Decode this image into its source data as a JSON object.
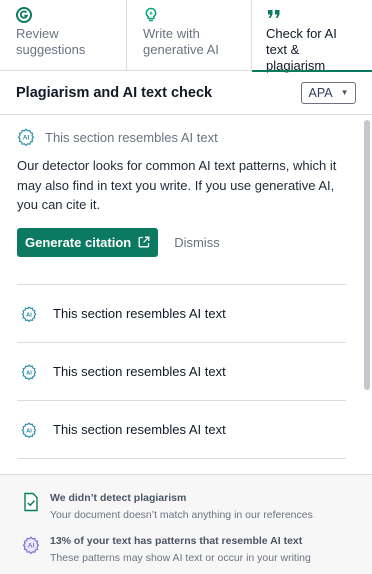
{
  "tabs": [
    {
      "label": "Review\nsuggestions",
      "icon": "grammarly-g-icon",
      "color": "#0b7a60"
    },
    {
      "label": "Write with\ngenerative AI",
      "icon": "lightbulb-icon",
      "color": "#14a37f"
    },
    {
      "label": "Check for AI\ntext & plagiarism",
      "icon": "quote-icon",
      "color": "#0b7a60",
      "active": true
    }
  ],
  "panel": {
    "title": "Plagiarism and AI text check",
    "citation_style": "APA"
  },
  "ai_section": {
    "header_text": "This section resembles AI text",
    "description": "Our detector looks for common AI text patterns, which it may also find in text you write. If you use generative AI, you can cite it.",
    "generate_citation_label": "Generate citation",
    "dismiss_label": "Dismiss"
  },
  "items": [
    {
      "text": "This section resembles AI text"
    },
    {
      "text": "This section resembles AI text"
    },
    {
      "text": "This section resembles AI text"
    }
  ],
  "footer": {
    "plagiarism_title": "We didn’t detect plagiarism",
    "plagiarism_subtitle": "Your document doesn’t match anything in our references",
    "ai_title": "13% of your text has patterns that resemble AI text",
    "ai_subtitle": "These patterns may show AI text or occur in your writing"
  },
  "colors": {
    "accent": "#0b7a60",
    "ai_icon": "#2f8fa8",
    "ai_badge": "#7c6fd6"
  }
}
